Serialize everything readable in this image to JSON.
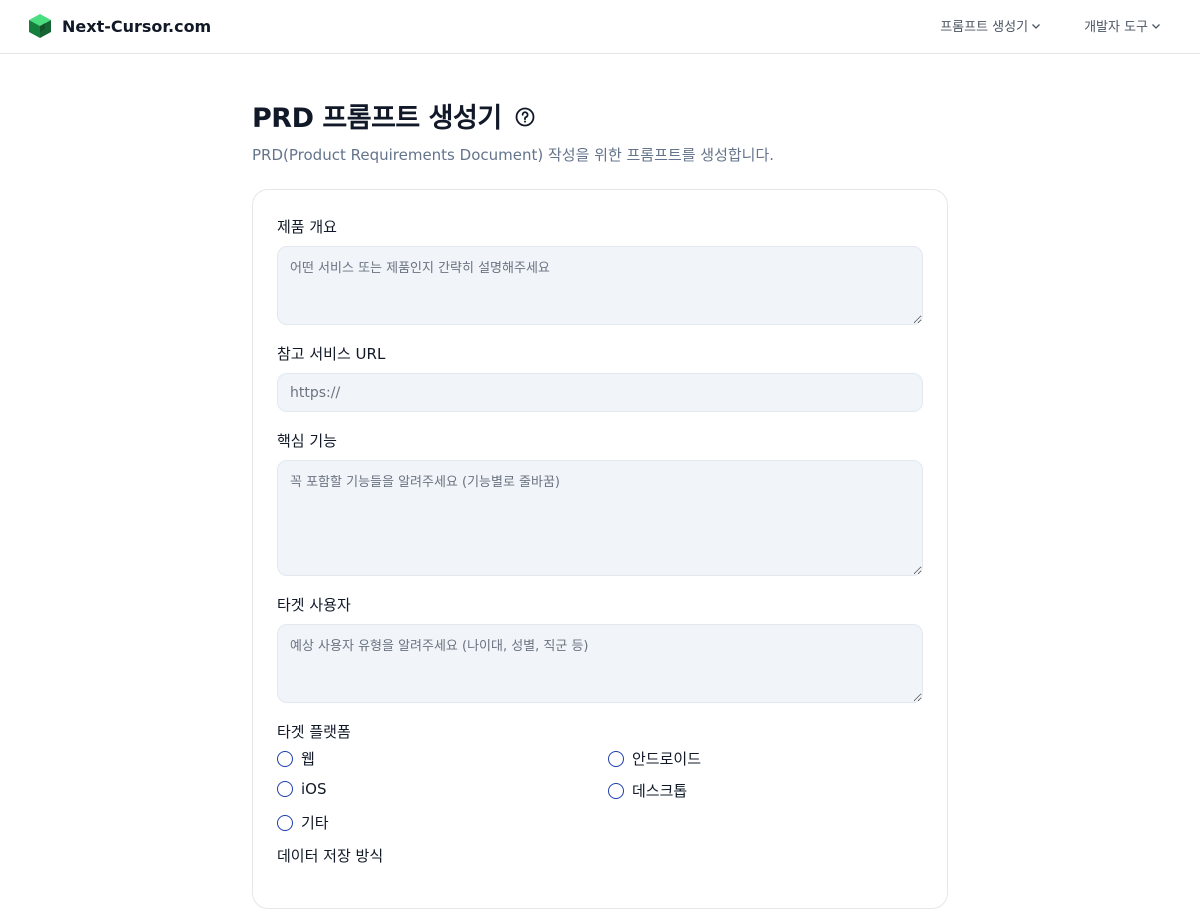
{
  "header": {
    "brand": "Next-Cursor.com",
    "nav": [
      {
        "label": "프롬프트 생성기"
      },
      {
        "label": "개발자 도구"
      }
    ]
  },
  "page": {
    "title": "PRD 프롬프트 생성기",
    "description": "PRD(Product Requirements Document) 작성을 위한 프롬프트를 생성합니다."
  },
  "form": {
    "overview": {
      "label": "제품 개요",
      "placeholder": "어떤 서비스 또는 제품인지 간략히 설명해주세요",
      "value": ""
    },
    "ref_url": {
      "label": "참고 서비스 URL",
      "placeholder": "https://",
      "value": ""
    },
    "features": {
      "label": "핵심 기능",
      "placeholder": "꼭 포함할 기능들을 알려주세요 (기능별로 줄바꿈)",
      "value": ""
    },
    "target_users": {
      "label": "타겟 사용자",
      "placeholder": "예상 사용자 유형을 알려주세요 (나이대, 성별, 직군 등)",
      "value": ""
    },
    "platform": {
      "label": "타겟 플랫폼",
      "options": [
        {
          "label": "웹",
          "selected": false
        },
        {
          "label": "안드로이드",
          "selected": false
        },
        {
          "label": "iOS",
          "selected": false
        },
        {
          "label": "데스크톱",
          "selected": false
        },
        {
          "label": "기타",
          "selected": false
        }
      ]
    },
    "next_section_label": "데이터 저장 방식"
  },
  "colors": {
    "accent": "#1e40af",
    "input_bg": "#f1f5f9",
    "muted_text": "#64748b"
  }
}
